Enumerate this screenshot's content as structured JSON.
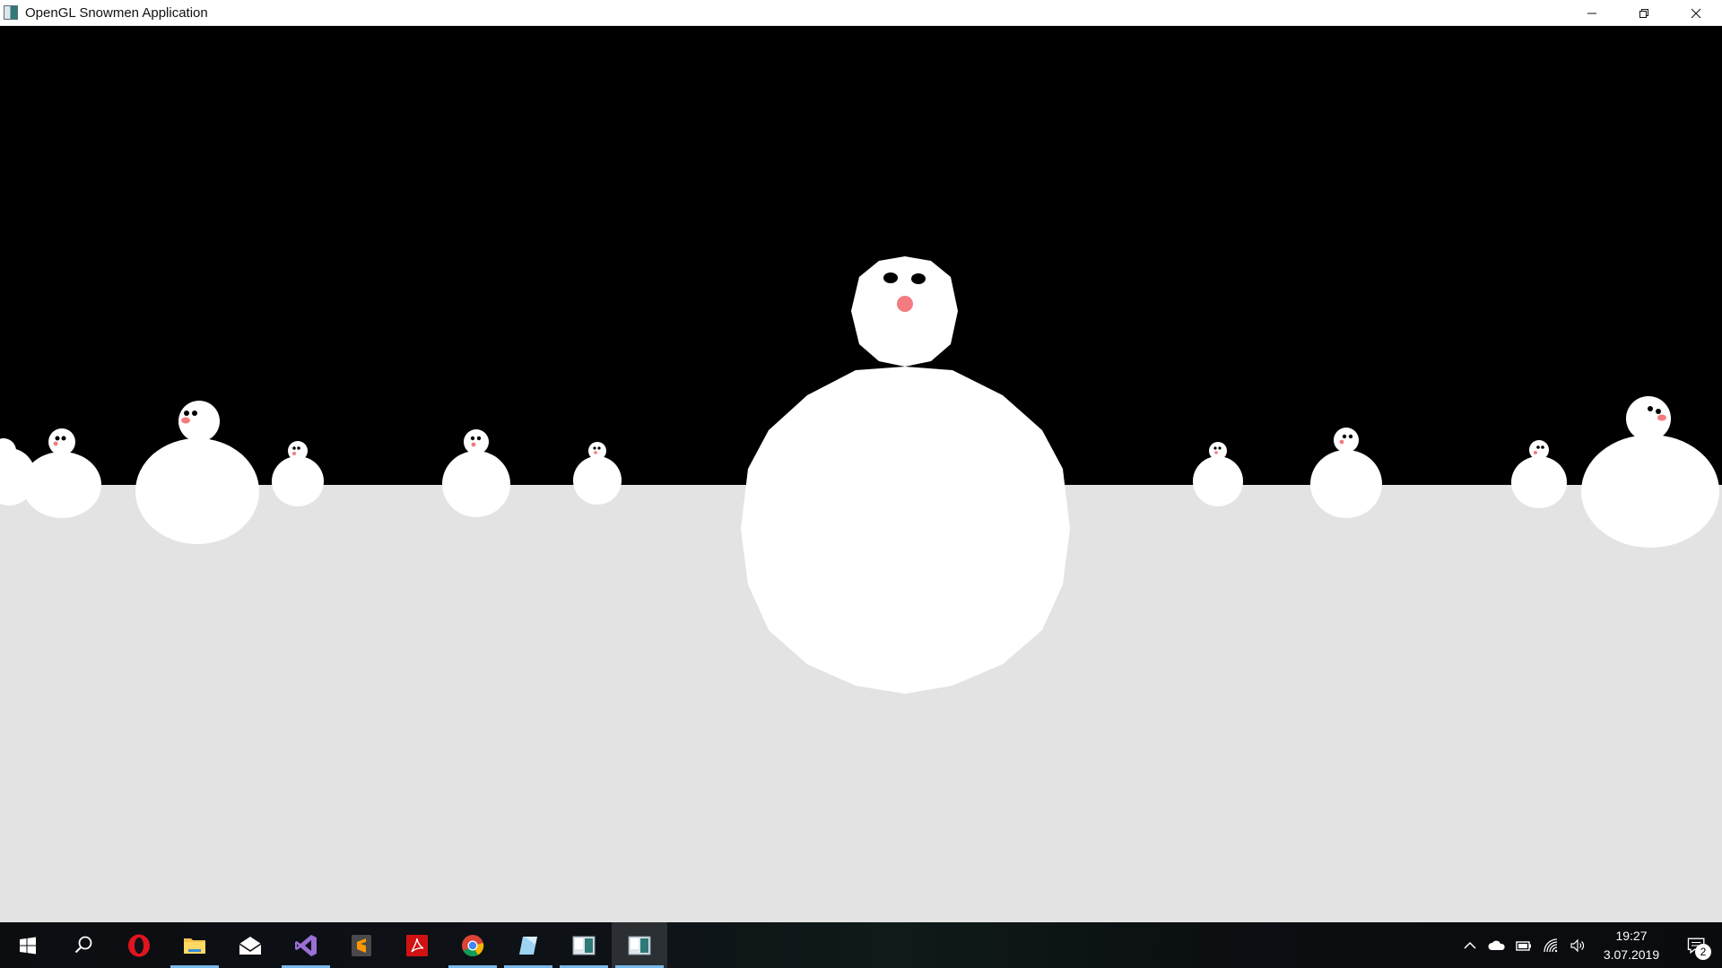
{
  "window": {
    "title": "OpenGL Snowmen Application",
    "controls": {
      "minimize": "minimize-icon",
      "restore": "restore-icon",
      "close": "close-icon"
    }
  },
  "scene": {
    "sky_color": "#000000",
    "ground_color": "#e3e3e3",
    "snow_color": "#ffffff",
    "eye_color": "#000000",
    "nose_color": "#f47c80"
  },
  "taskbar": {
    "items": [
      {
        "name": "start-button",
        "icon": "windows-logo-icon"
      },
      {
        "name": "search-button",
        "icon": "search-icon"
      },
      {
        "name": "opera-button",
        "icon": "opera-icon"
      },
      {
        "name": "file-explorer-button",
        "icon": "folder-icon"
      },
      {
        "name": "mail-button",
        "icon": "mail-icon"
      },
      {
        "name": "visual-studio-button",
        "icon": "visual-studio-icon"
      },
      {
        "name": "sublime-text-button",
        "icon": "sublime-icon"
      },
      {
        "name": "acrobat-button",
        "icon": "acrobat-icon"
      },
      {
        "name": "chrome-button",
        "icon": "chrome-icon"
      },
      {
        "name": "notes-button",
        "icon": "notes-icon"
      },
      {
        "name": "app-window-button",
        "icon": "app-window-icon"
      },
      {
        "name": "snowmen-app-button",
        "icon": "app-window-icon"
      }
    ],
    "tray": {
      "time": "19:27",
      "date": "3.07.2019",
      "notification_count": "2"
    }
  }
}
